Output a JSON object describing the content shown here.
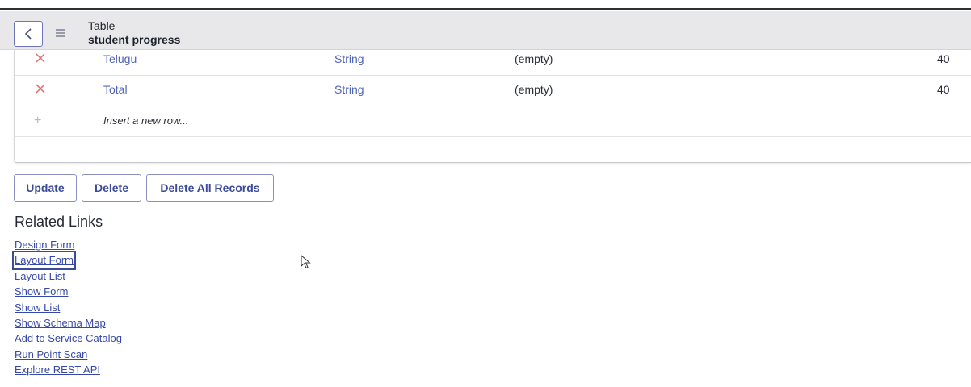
{
  "header": {
    "line1": "Table",
    "line2": "student progress",
    "back_icon": "chevron-left-icon",
    "menu_icon": "hamburger-menu-icon"
  },
  "table": {
    "rows": [
      {
        "name": "Telugu",
        "type": "String",
        "default": "(empty)",
        "max_length": "40"
      },
      {
        "name": "Total",
        "type": "String",
        "default": "(empty)",
        "max_length": "40"
      }
    ],
    "insert_placeholder": "Insert a new row..."
  },
  "buttons": {
    "update": "Update",
    "delete": "Delete",
    "delete_all": "Delete All Records"
  },
  "related_links": {
    "title": "Related Links",
    "items": [
      "Design Form",
      "Layout Form",
      "Layout List",
      "Show Form",
      "Show List",
      "Show Schema Map",
      "Add to Service Catalog",
      "Run Point Scan",
      "Explore REST API"
    ],
    "focused_item": "Layout Form"
  },
  "colors": {
    "link": "#3548a8",
    "field_link": "#4f63b8",
    "delete_x": "#e06a6a",
    "button_border": "#8a8fc0",
    "header_bg": "#e8e8ea"
  }
}
